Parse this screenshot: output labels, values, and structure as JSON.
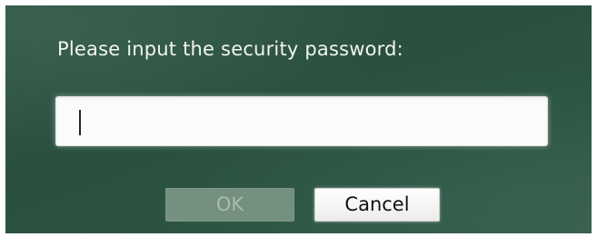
{
  "dialog": {
    "prompt": "Please input the security password:",
    "password_field": {
      "value": "",
      "placeholder": ""
    },
    "buttons": {
      "ok_label": "OK",
      "ok_enabled": false,
      "cancel_label": "Cancel"
    }
  },
  "colors": {
    "background": "#2c5443",
    "prompt_text": "#f2f4f2",
    "ok_disabled_bg": "#75907f",
    "ok_disabled_text": "#a9bcb0",
    "cancel_bg": "#ffffff"
  }
}
